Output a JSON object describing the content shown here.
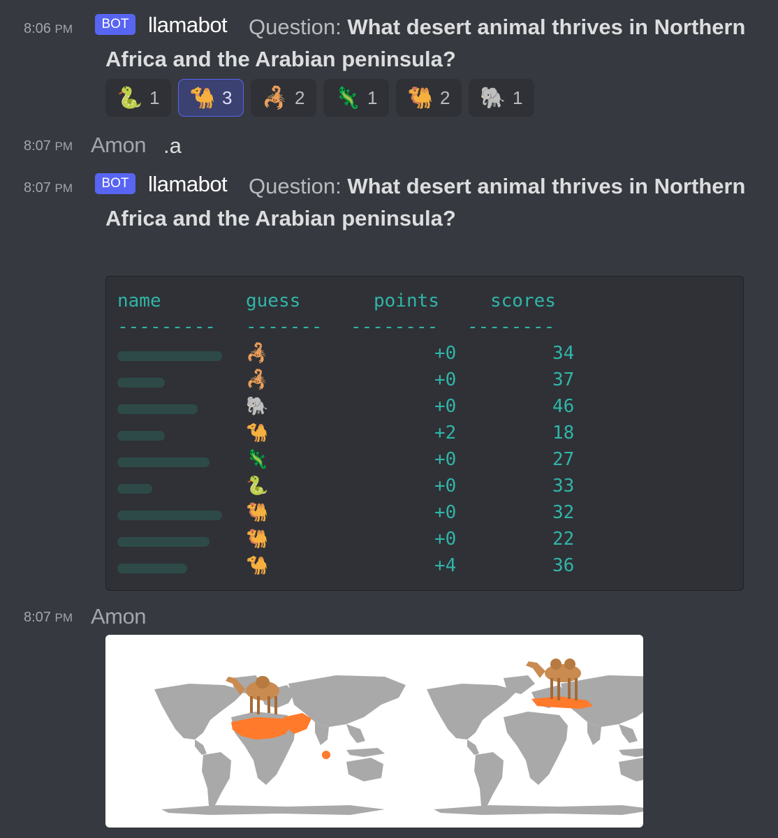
{
  "messages": [
    {
      "time": "8:06",
      "period": "PM",
      "bot_tag": "BOT",
      "author": "llamabot",
      "question_label": "Question:",
      "question_text": "What desert animal thrives in Northern",
      "question_text_2": "Africa and the Arabian peninsula?",
      "reactions": [
        {
          "icon": "snake-icon",
          "glyph": "🐍",
          "count": "1",
          "active": false
        },
        {
          "icon": "dromedary-camel-icon",
          "glyph": "🐪",
          "count": "3",
          "active": true
        },
        {
          "icon": "scorpion-icon",
          "glyph": "🦂",
          "count": "2",
          "active": false
        },
        {
          "icon": "lizard-icon",
          "glyph": "🦎",
          "count": "1",
          "active": false
        },
        {
          "icon": "bactrian-camel-icon",
          "glyph": "🐫",
          "count": "2",
          "active": false
        },
        {
          "icon": "elephant-icon",
          "glyph": "🐘",
          "count": "1",
          "active": false
        }
      ]
    },
    {
      "time": "8:07",
      "period": "PM",
      "author": "Amon",
      "text": ".a"
    },
    {
      "time": "8:07",
      "period": "PM",
      "bot_tag": "BOT",
      "author": "llamabot",
      "question_label": "Question:",
      "question_text": "What desert animal thrives in Northern",
      "question_text_2": "Africa and the Arabian peninsula?",
      "table": {
        "headers": [
          "name",
          "guess",
          "points",
          "scores"
        ],
        "separators": [
          "---------",
          "-------",
          "--------",
          "--------"
        ],
        "rows": [
          {
            "guess": "🦂",
            "guess_icon": "scorpion-icon",
            "points": "+0",
            "score": "34"
          },
          {
            "guess": "🦂",
            "guess_icon": "scorpion-icon",
            "points": "+0",
            "score": "37"
          },
          {
            "guess": "🐘",
            "guess_icon": "elephant-icon",
            "points": "+0",
            "score": "46"
          },
          {
            "guess": "🐪",
            "guess_icon": "dromedary-camel-icon",
            "points": "+2",
            "score": "18"
          },
          {
            "guess": "🦎",
            "guess_icon": "lizard-icon",
            "points": "+0",
            "score": "27"
          },
          {
            "guess": "🐍",
            "guess_icon": "snake-icon",
            "points": "+0",
            "score": "33"
          },
          {
            "guess": "🐫",
            "guess_icon": "bactrian-camel-icon",
            "points": "+0",
            "score": "32"
          },
          {
            "guess": "🐫",
            "guess_icon": "bactrian-camel-icon",
            "points": "+0",
            "score": "22"
          },
          {
            "guess": "🐪",
            "guess_icon": "dromedary-camel-icon",
            "points": "+4",
            "score": "36"
          }
        ]
      }
    },
    {
      "time": "8:07",
      "period": "PM",
      "author": "Amon",
      "image": "camel-range-maps"
    }
  ],
  "colors": {
    "background": "#36393f",
    "bot_tag": "#5865f2",
    "code_text": "#30b5a8",
    "range_highlight": "#ff7a2a",
    "land": "#a9a9a9"
  }
}
